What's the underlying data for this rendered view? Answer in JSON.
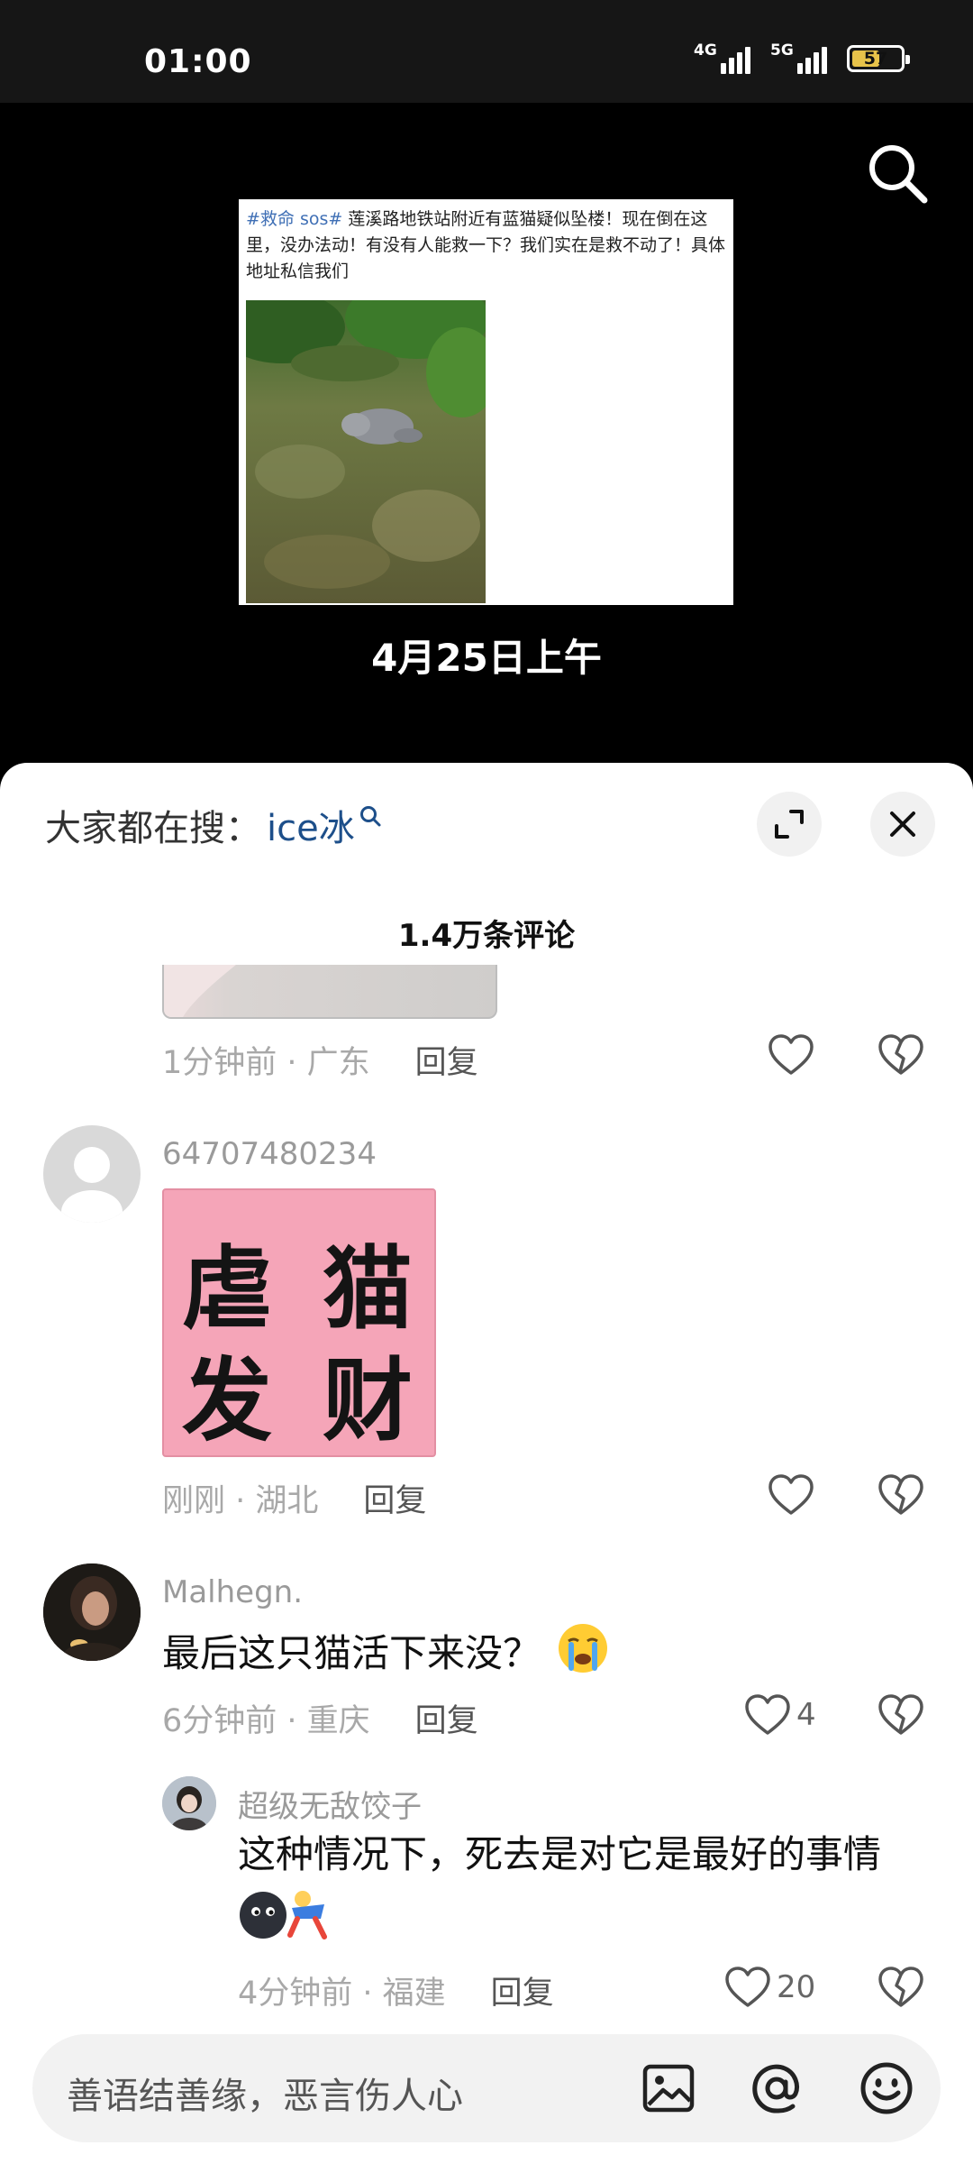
{
  "status_bar": {
    "time": "01:00",
    "signal1_label": "4G",
    "signal2_label": "5G",
    "battery": "57",
    "battery_level": 57
  },
  "video": {
    "post_tag": "#救命 sos#",
    "post_text": " 莲溪路地铁站附近有蓝猫疑似坠楼！现在倒在这里，没办法动！有没有人能救一下？我们实在是救不动了！具体地址私信我们",
    "caption": "4月25日上午"
  },
  "sheet": {
    "search_prefix": "大家都在搜：",
    "search_keyword": "ice冰",
    "comment_count": "1.4万条评论"
  },
  "comments": [
    {
      "time_location": "1分钟前 · 广东",
      "reply_label": "回复"
    },
    {
      "username": "64707480234",
      "sticker": [
        "虐",
        "猫",
        "发",
        "财"
      ],
      "time_location": "刚刚 · 湖北",
      "reply_label": "回复"
    },
    {
      "username": "Malhegn.",
      "text": "最后这只猫活下来没？",
      "time_location": "6分钟前 · 重庆",
      "reply_label": "回复",
      "likes": "4"
    },
    {
      "username": "超级无敌饺子",
      "text": "这种情况下，死去是对它是最好的事情",
      "time_location": "4分钟前 · 福建",
      "reply_label": "回复",
      "likes": "20"
    }
  ],
  "input": {
    "placeholder": "善语结善缘，恶言伤人心"
  },
  "colors": {
    "keyword": "#1d4f8a",
    "tag": "#3f6fb5",
    "sticker_bg": "#f5a5b8"
  }
}
